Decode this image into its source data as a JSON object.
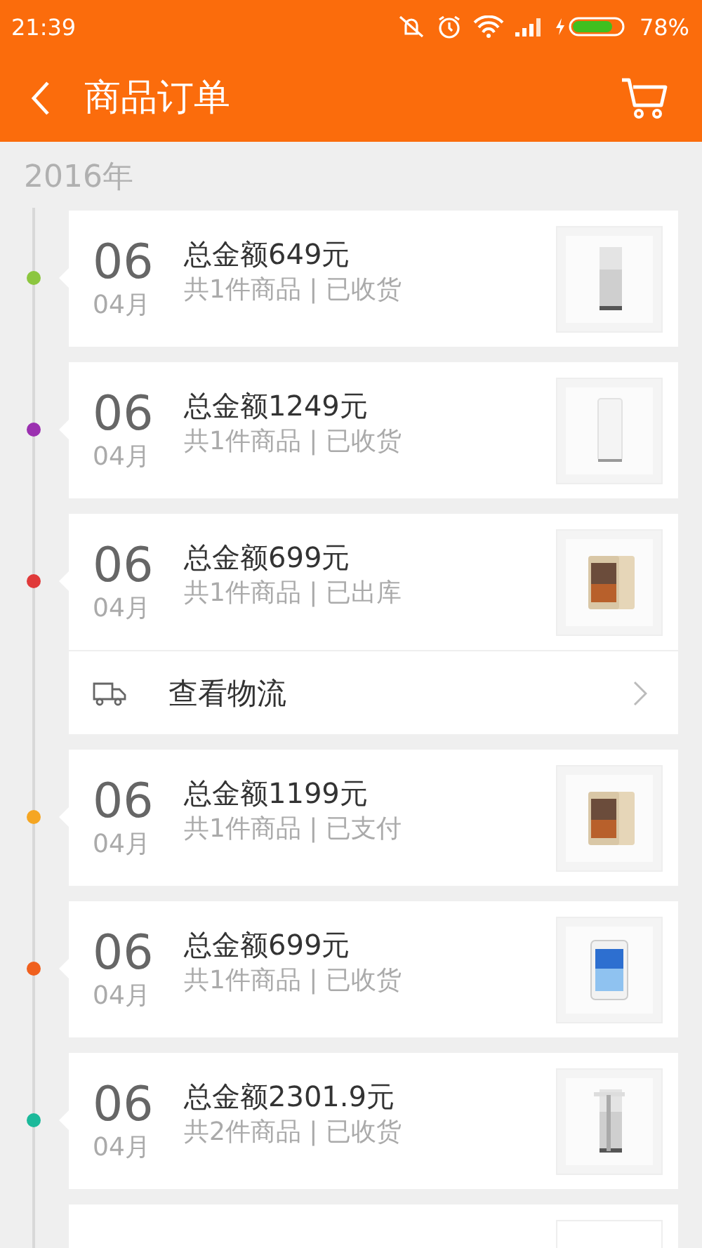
{
  "status_bar": {
    "time": "21:39",
    "battery": "78%"
  },
  "header": {
    "title": "商品订单"
  },
  "year": "2016年",
  "orders": [
    {
      "day": "06",
      "month": "04月",
      "total": "总金额649元",
      "summary": "共1件商品 | 已收货",
      "color": "#8cc63f"
    },
    {
      "day": "06",
      "month": "04月",
      "total": "总金额1249元",
      "summary": "共1件商品 | 已收货",
      "color": "#9b30b0"
    },
    {
      "day": "06",
      "month": "04月",
      "total": "总金额699元",
      "summary": "共1件商品 | 已出库",
      "color": "#e03a3a",
      "logistics": {
        "label": "查看物流"
      }
    },
    {
      "day": "06",
      "month": "04月",
      "total": "总金额1199元",
      "summary": "共1件商品 | 已支付",
      "color": "#f5a623"
    },
    {
      "day": "06",
      "month": "04月",
      "total": "总金额699元",
      "summary": "共1件商品 | 已收货",
      "color": "#f0601e"
    },
    {
      "day": "06",
      "month": "04月",
      "total": "总金额2301.9元",
      "summary": "共2件商品 | 已收货",
      "color": "#1bb99a"
    }
  ]
}
